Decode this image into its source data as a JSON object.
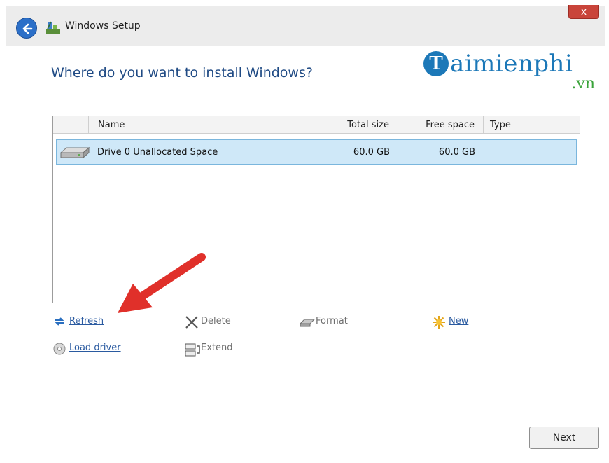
{
  "window": {
    "title": "Windows Setup",
    "close_label": "x"
  },
  "brand": {
    "initial": "T",
    "name": "aimienphi",
    "suffix": ".vn"
  },
  "heading": "Where do you want to install Windows?",
  "table": {
    "columns": [
      "Name",
      "Total size",
      "Free space",
      "Type"
    ],
    "rows": [
      {
        "name": "Drive 0 Unallocated Space",
        "total": "60.0 GB",
        "free": "60.0 GB",
        "type": ""
      }
    ]
  },
  "actions": {
    "refresh": "Refresh",
    "delete": "Delete",
    "format": "Format",
    "new": "New",
    "load_driver": "Load driver",
    "extend": "Extend"
  },
  "next_label": "Next",
  "colors": {
    "accent": "#1f4a84",
    "selection": "#cfe8f8",
    "annotation_arrow": "#e0302a"
  }
}
